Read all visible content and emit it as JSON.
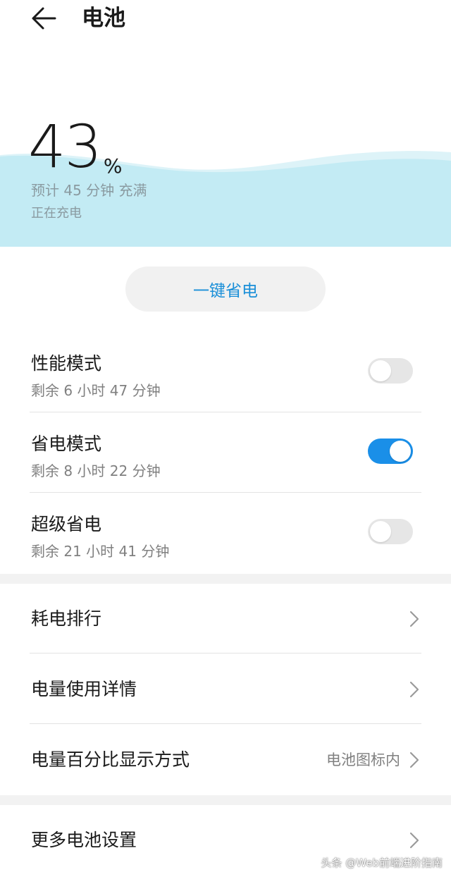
{
  "header": {
    "title": "电池"
  },
  "battery": {
    "percent": "43",
    "percent_sign": "%",
    "estimate": "预计 45 分钟 充满",
    "status": "正在充电",
    "wave_color": "#c3ebf4"
  },
  "save_button": {
    "label": "一键省电"
  },
  "modes": [
    {
      "title": "性能模式",
      "subtitle": "剩余 6 小时 47 分钟",
      "enabled": false
    },
    {
      "title": "省电模式",
      "subtitle": "剩余 8 小时 22 分钟",
      "enabled": true
    },
    {
      "title": "超级省电",
      "subtitle": "剩余 21 小时 41 分钟",
      "enabled": false
    }
  ],
  "nav_items": [
    {
      "label": "耗电排行",
      "value": ""
    },
    {
      "label": "电量使用详情",
      "value": ""
    },
    {
      "label": "电量百分比显示方式",
      "value": "电池图标内"
    },
    {
      "label": "更多电池设置",
      "value": ""
    }
  ],
  "watermark": "头条 @Web前端进阶指南",
  "colors": {
    "accent": "#1a8fe8",
    "toggle_off": "#e6e6e6",
    "section_gap": "#f2f2f2"
  }
}
